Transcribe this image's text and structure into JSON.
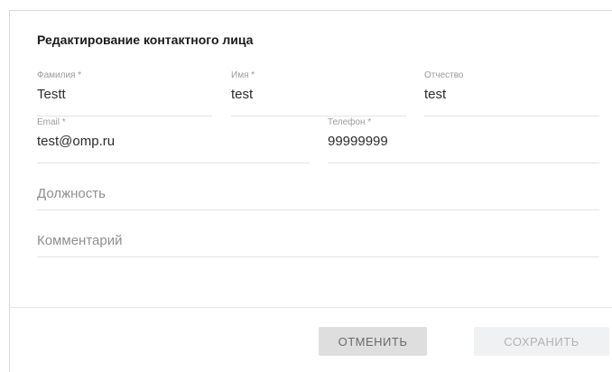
{
  "dialog": {
    "title": "Редактирование контактного лица"
  },
  "fields": {
    "last_name": {
      "label": "Фамилия *",
      "value": "Testt"
    },
    "first_name": {
      "label": "Имя *",
      "value": "test"
    },
    "middle_name": {
      "label": "Отчество",
      "value": "test"
    },
    "email": {
      "label": "Email *",
      "value": "test@omp.ru"
    },
    "phone": {
      "label": "Телефон *",
      "value": "99999999"
    },
    "position": {
      "placeholder": "Должность",
      "value": ""
    },
    "comment": {
      "placeholder": "Комментарий",
      "value": ""
    }
  },
  "buttons": {
    "cancel_label": "ОТМЕНИТЬ",
    "save_label": "СОХРАНИТЬ"
  }
}
